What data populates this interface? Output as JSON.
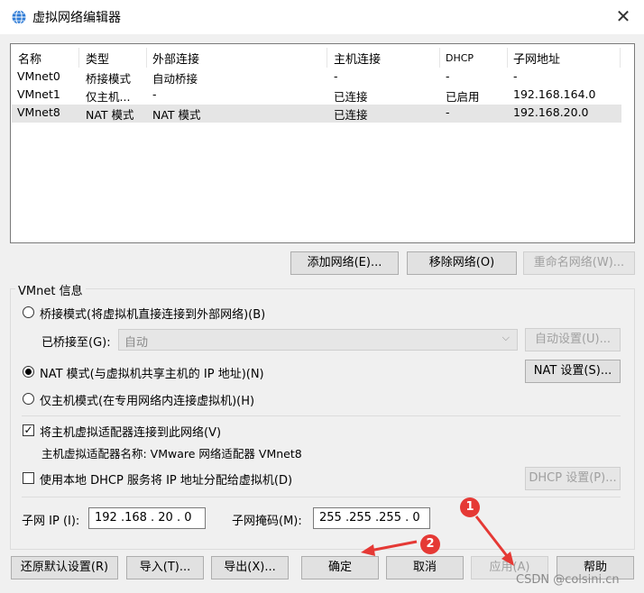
{
  "window": {
    "title": "虚拟网络编辑器",
    "close": "✕"
  },
  "table": {
    "headers": [
      "名称",
      "类型",
      "外部连接",
      "主机连接",
      "DHCP",
      "子网地址"
    ],
    "rows": [
      [
        "VMnet0",
        "桥接模式",
        "自动桥接",
        "-",
        "-",
        "-"
      ],
      [
        "VMnet1",
        "仅主机...",
        "-",
        "已连接",
        "已启用",
        "192.168.164.0"
      ],
      [
        "VMnet8",
        "NAT 模式",
        "NAT 模式",
        "已连接",
        "-",
        "192.168.20.0"
      ]
    ],
    "selected_row": 2
  },
  "list_buttons": {
    "add": "添加网络(E)...",
    "remove": "移除网络(O)",
    "rename": "重命名网络(W)..."
  },
  "vmnet_info": {
    "label": "VMnet 信息",
    "bridge_radio": "桥接模式(将虚拟机直接连接到外部网络)(B)",
    "bridged_to_label": "已桥接至(G):",
    "bridged_to_value": "自动",
    "auto_settings": "自动设置(U)...",
    "nat_radio": "NAT 模式(与虚拟机共享主机的 IP 地址)(N)",
    "nat_settings": "NAT 设置(S)...",
    "host_only_radio": "仅主机模式(在专用网络内连接虚拟机)(H)",
    "connect_adapter": "将主机虚拟适配器连接到此网络(V)",
    "adapter_name": "主机虚拟适配器名称: VMware 网络适配器 VMnet8",
    "use_dhcp": "使用本地 DHCP 服务将 IP 地址分配给虚拟机(D)",
    "dhcp_settings": "DHCP 设置(P)...",
    "subnet_ip_label": "子网 IP (I):",
    "subnet_ip": "192 .168 . 20 .  0",
    "mask_label": "子网掩码(M):",
    "mask": "255 .255 .255 .  0"
  },
  "bottom_buttons": {
    "restore": "还原默认设置(R)",
    "import": "导入(T)...",
    "export": "导出(X)...",
    "ok": "确定",
    "cancel": "取消",
    "apply": "应用(A)",
    "help": "帮助"
  },
  "annotations": {
    "badge1": "1",
    "badge2": "2"
  },
  "watermark": "CSDN @colsini.cn",
  "colors": {
    "accent_red": "#e53935",
    "selection": "#e5e5e5"
  }
}
